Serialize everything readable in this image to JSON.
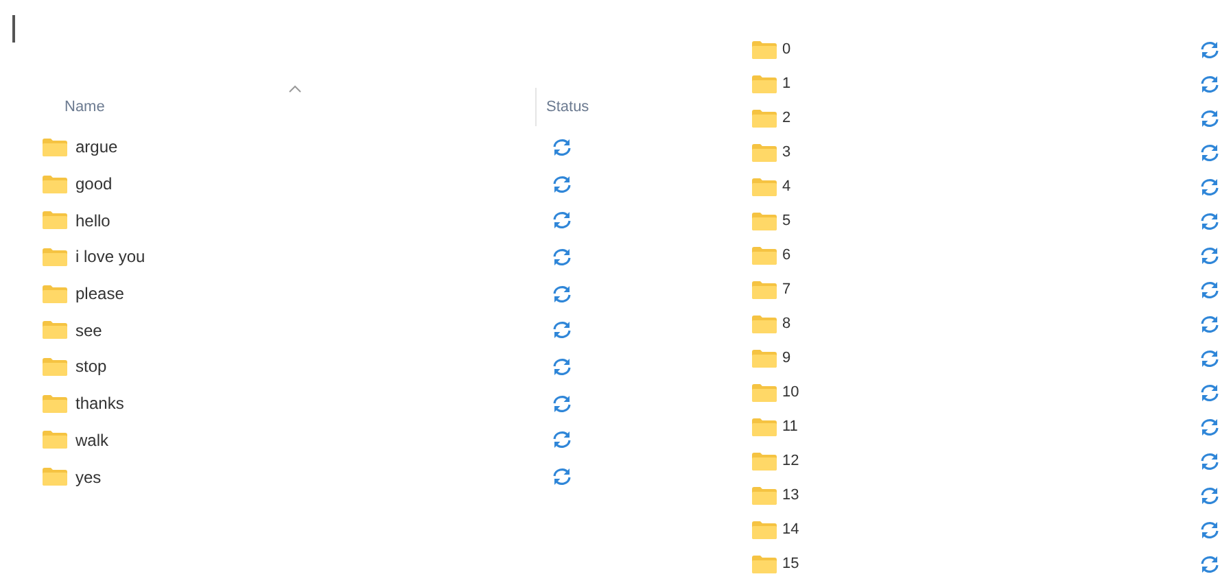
{
  "left_list": {
    "columns": [
      {
        "label": "Name",
        "sorted": true
      },
      {
        "label": "Status"
      }
    ],
    "rows": [
      {
        "name": "argue"
      },
      {
        "name": "good"
      },
      {
        "name": "hello"
      },
      {
        "name": "i love you"
      },
      {
        "name": "please"
      },
      {
        "name": "see"
      },
      {
        "name": "stop"
      },
      {
        "name": "thanks"
      },
      {
        "name": "walk"
      },
      {
        "name": "yes"
      }
    ]
  },
  "right_list": {
    "rows": [
      {
        "name": "0"
      },
      {
        "name": "1"
      },
      {
        "name": "2"
      },
      {
        "name": "3"
      },
      {
        "name": "4"
      },
      {
        "name": "5"
      },
      {
        "name": "6"
      },
      {
        "name": "7"
      },
      {
        "name": "8"
      },
      {
        "name": "9"
      },
      {
        "name": "10"
      },
      {
        "name": "11"
      },
      {
        "name": "12"
      },
      {
        "name": "13"
      },
      {
        "name": "14"
      },
      {
        "name": "15"
      }
    ]
  }
}
